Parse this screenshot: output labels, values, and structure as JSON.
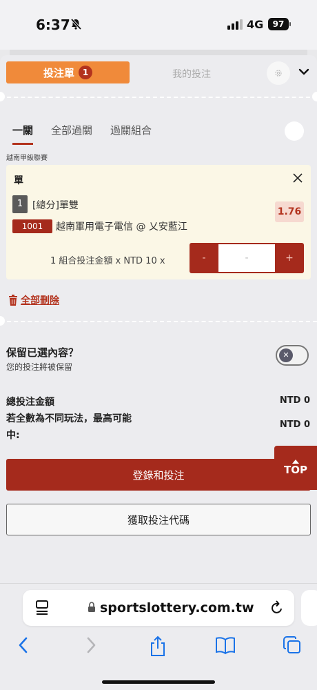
{
  "status": {
    "time": "6:37",
    "network": "4G",
    "battery": "97"
  },
  "tabs": {
    "bet_slip": "投注單",
    "bet_slip_count": "1",
    "my_bets": "我的投注"
  },
  "subtabs": [
    "一關",
    "全部過關",
    "過關組合"
  ],
  "league": "越南甲級聯賽",
  "bet": {
    "title": "單",
    "index": "1",
    "type": "[總分]單雙",
    "odds": "1.76",
    "match_code": "1001",
    "match": "越南軍用電子電信 @ 乂安藍江",
    "stake_label": "1 組合投注金額 x NTD 10 x",
    "minus": "-",
    "amount_placeholder": "-",
    "plus": "+"
  },
  "delete_all": "全部刪除",
  "keep": {
    "title": "保留已選內容？",
    "subtitle": "您的投注將被保留",
    "toggle_symbol": "✕"
  },
  "summary": {
    "total_label": "總投注金額",
    "total_value": "NTD 0",
    "max_label_line1": "若全數為不同玩法，最高可能",
    "max_label_line2": "中:",
    "max_value": "NTD 0"
  },
  "top_button": "TOP",
  "actions": {
    "login_bet": "登錄和投注",
    "get_code": "獲取投注代碼"
  },
  "browser": {
    "url": "sportslottery.com.tw"
  },
  "colors": {
    "accent": "#a52a1c",
    "orange": "#f08a3a",
    "safari_blue": "#1a73e8"
  }
}
